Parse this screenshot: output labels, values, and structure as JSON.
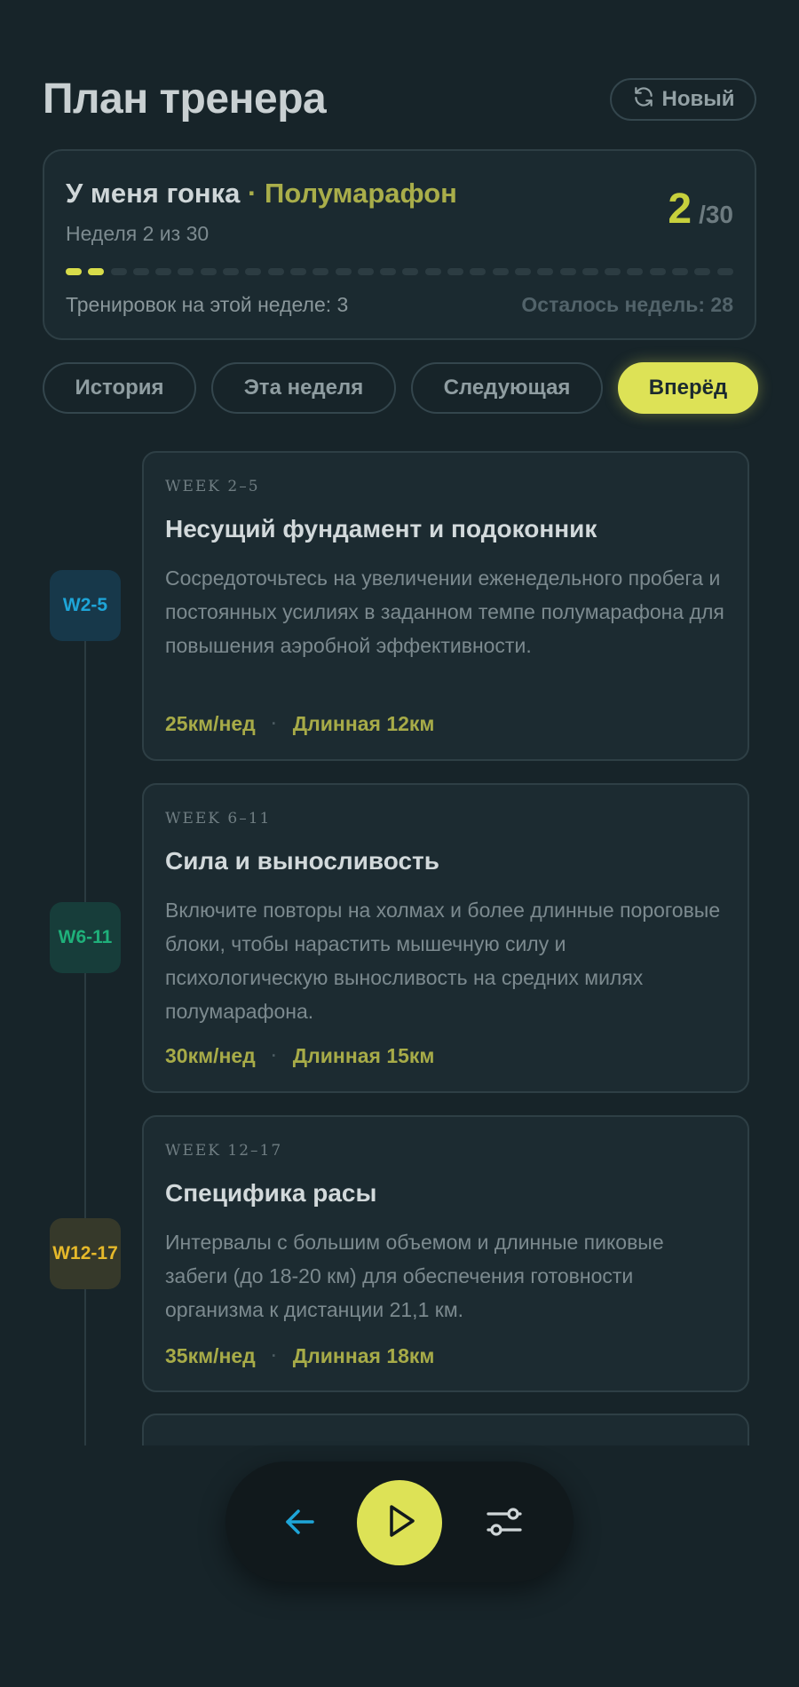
{
  "header": {
    "title": "План тренера",
    "new_button": "Новый",
    "new_icon": "refresh-icon"
  },
  "plan": {
    "title_prefix": "У меня гонка",
    "title_separator": "·",
    "title_accent": "Полумарафон",
    "subtitle": "Неделя 2 из 30",
    "current_week": "2",
    "total_weeks": "/30",
    "progress": {
      "completed": 2,
      "total": 30
    },
    "workouts_this_week": "Тренировок на этой неделе: 3",
    "weeks_left": "Осталось недель: 28"
  },
  "tabs": [
    {
      "label": "История",
      "active": false
    },
    {
      "label": "Эта неделя",
      "active": false
    },
    {
      "label": "Следующая",
      "active": false
    },
    {
      "label": "Вперёд",
      "active": true
    }
  ],
  "phases": [
    {
      "badge": "W2-5",
      "eyebrow": "WEEK 2–5",
      "title": "Несущий фундамент и подоконник",
      "text": "Сосредоточьтесь на увеличении еженедельного пробега и постоянных усилиях в заданном темпе полумарафона для повышения аэробной эффективности.",
      "volume": "25км/нед",
      "separator": "·",
      "long_run": "Длинная 12км"
    },
    {
      "badge": "W6-11",
      "eyebrow": "WEEK 6–11",
      "title": "Сила и выносливость",
      "text": "Включите повторы на холмах и более длинные пороговые блоки, чтобы нарастить мышечную силу и психологическую выносливость на средних милях полумарафона.",
      "volume": "30км/нед",
      "separator": "·",
      "long_run": "Длинная 15км"
    },
    {
      "badge": "W12-17",
      "eyebrow": "WEEK 12–17",
      "title": "Специфика расы",
      "text": "Интервалы с большим объемом и длинные пиковые забеги (до 18-20 км) для обеспечения готовности организма к дистанции 21,1 км.",
      "volume": "35км/нед",
      "separator": "·",
      "long_run": "Длинная 18км"
    }
  ],
  "bottom_bar": {
    "back_icon": "arrow-left-icon",
    "play_icon": "play-icon",
    "settings_icon": "sliders-icon"
  },
  "colors": {
    "background": "#172429",
    "accent": "#dde256",
    "accent_text": "#a9ae4a",
    "phase1": "#1ea5d8",
    "phase2": "#1fb07a",
    "phase3": "#e6b92a"
  }
}
